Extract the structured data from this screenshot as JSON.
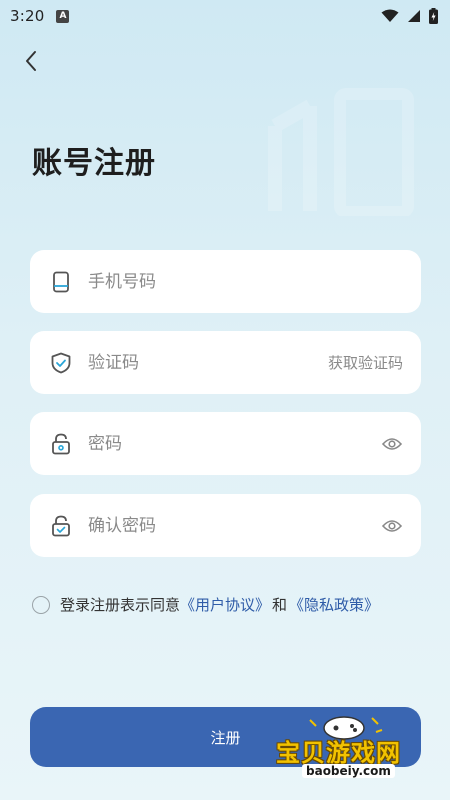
{
  "status_bar": {
    "time": "3:20",
    "notification_badge": "A"
  },
  "page": {
    "title": "账号注册"
  },
  "form": {
    "phone": {
      "placeholder": "手机号码",
      "icon": "phone-icon"
    },
    "code": {
      "placeholder": "验证码",
      "icon": "shield-check-icon",
      "action_label": "获取验证码"
    },
    "password": {
      "placeholder": "密码",
      "icon": "unlock-icon"
    },
    "confirm_password": {
      "placeholder": "确认密码",
      "icon": "lock-check-icon"
    }
  },
  "agreement": {
    "prefix": "登录注册表示同意",
    "user_agreement": "《用户协议》",
    "conjunction": "和",
    "privacy_policy": "《隐私政策》"
  },
  "submit": {
    "label": "注册"
  },
  "watermark": {
    "text": "宝贝游戏网",
    "url": "baobeiy.com"
  },
  "colors": {
    "primary": "#3a66b2",
    "link": "#2f5ca8",
    "accent": "#2aa6d8"
  }
}
